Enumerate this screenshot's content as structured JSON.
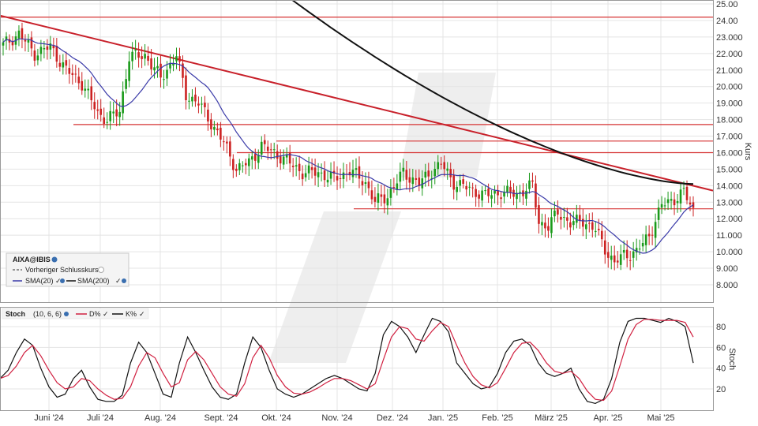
{
  "chart_data": [
    {
      "type": "candlestick",
      "symbol": "AIXA@IBIS",
      "ylabel": "Kurs",
      "ylim": [
        7.0,
        25.0
      ],
      "y_ticks": [
        "8.000",
        "9.000",
        "10.000",
        "11.000",
        "12.000",
        "13.000",
        "14.000",
        "15.000",
        "16.000",
        "17.000",
        "18.000",
        "19.000",
        "20.000",
        "21.000",
        "22.000",
        "23.000",
        "24.00",
        "25.00"
      ],
      "x_labels": [
        "Juni '24",
        "Juli '24",
        "Aug. '24",
        "Sept. '24",
        "Okt. '24",
        "Nov. '24",
        "Dez. '24",
        "Jan. '25",
        "Feb. '25",
        "März '25",
        "Apr. '25",
        "Mai '25"
      ],
      "legend": {
        "title": "AIXA@IBIS",
        "items": [
          "Vorheriger Schlusskurs",
          "SMA(20)",
          "SMA(200)"
        ]
      },
      "close_anchors": [
        [
          0,
          22.5
        ],
        [
          5,
          23.2
        ],
        [
          10,
          22.0
        ],
        [
          15,
          22.4
        ],
        [
          20,
          21.0
        ],
        [
          25,
          20.2
        ],
        [
          30,
          18.4
        ],
        [
          33,
          18.0
        ],
        [
          37,
          18.5
        ],
        [
          40,
          21.8
        ],
        [
          45,
          21.9
        ],
        [
          50,
          20.5
        ],
        [
          55,
          21.9
        ],
        [
          58,
          19.5
        ],
        [
          62,
          19.0
        ],
        [
          66,
          17.8
        ],
        [
          70,
          16.6
        ],
        [
          74,
          15.0
        ],
        [
          78,
          15.4
        ],
        [
          82,
          16.4
        ],
        [
          86,
          16.0
        ],
        [
          90,
          15.5
        ],
        [
          95,
          14.8
        ],
        [
          100,
          14.8
        ],
        [
          105,
          14.4
        ],
        [
          110,
          14.9
        ],
        [
          115,
          14.2
        ],
        [
          118,
          13.0
        ],
        [
          122,
          13.4
        ],
        [
          127,
          14.8
        ],
        [
          132,
          14.1
        ],
        [
          136,
          14.9
        ],
        [
          139,
          15.3
        ],
        [
          143,
          14.2
        ],
        [
          148,
          13.8
        ],
        [
          153,
          13.4
        ],
        [
          158,
          13.6
        ],
        [
          163,
          13.5
        ],
        [
          168,
          14.0
        ],
        [
          170,
          11.8
        ],
        [
          173,
          11.5
        ],
        [
          176,
          12.4
        ],
        [
          180,
          11.7
        ],
        [
          184,
          11.9
        ],
        [
          188,
          11.3
        ],
        [
          191,
          10.2
        ],
        [
          194,
          9.3
        ],
        [
          197,
          9.8
        ],
        [
          201,
          10.0
        ],
        [
          205,
          11.0
        ],
        [
          209,
          12.8
        ],
        [
          213,
          13.2
        ],
        [
          216,
          13.6
        ],
        [
          219,
          12.5
        ]
      ],
      "close_start": 22.5,
      "close_end": 12.5,
      "sma200_start": 27.2,
      "sma200_end": 14.1,
      "resistance_levels": [
        24.2,
        17.7,
        16.7,
        16.0,
        12.6
      ],
      "trendline": {
        "start": 24.3,
        "end": 13.7
      },
      "line_colors": {
        "price_up": "#1a9a1a",
        "price_down": "#cc2222",
        "sma20": "#3a3aa8",
        "sma200": "#111111",
        "levels": "#d63333",
        "trend": "#c8202a"
      }
    },
    {
      "type": "line",
      "title": "Stoch",
      "params": "(10, 6, 6)",
      "ylabel": "Stoch",
      "ylim": [
        0,
        100
      ],
      "y_ticks": [
        "20",
        "40",
        "60",
        "80"
      ],
      "series": [
        {
          "name": "K%",
          "color": "#111111",
          "values": [
            30,
            38,
            55,
            68,
            62,
            40,
            22,
            12,
            15,
            30,
            38,
            22,
            10,
            8,
            8,
            14,
            45,
            65,
            55,
            35,
            15,
            12,
            45,
            70,
            55,
            38,
            22,
            12,
            10,
            15,
            45,
            70,
            60,
            38,
            20,
            15,
            12,
            15,
            20,
            25,
            30,
            33,
            30,
            25,
            20,
            18,
            35,
            72,
            85,
            80,
            70,
            55,
            72,
            88,
            85,
            75,
            45,
            35,
            25,
            20,
            22,
            35,
            55,
            66,
            68,
            62,
            45,
            35,
            32,
            35,
            40,
            20,
            8,
            6,
            10,
            30,
            65,
            85,
            88,
            88,
            86,
            84,
            88,
            85,
            80,
            45
          ]
        },
        {
          "name": "D%",
          "color": "#d02040",
          "values": [
            30,
            33,
            42,
            55,
            62,
            52,
            38,
            26,
            20,
            22,
            30,
            28,
            20,
            14,
            10,
            11,
            22,
            42,
            55,
            50,
            35,
            22,
            26,
            48,
            56,
            48,
            35,
            22,
            15,
            13,
            25,
            50,
            62,
            50,
            33,
            22,
            16,
            15,
            17,
            21,
            26,
            30,
            30,
            28,
            24,
            20,
            25,
            48,
            70,
            80,
            78,
            68,
            66,
            76,
            84,
            80,
            62,
            45,
            32,
            24,
            21,
            26,
            40,
            55,
            64,
            65,
            57,
            45,
            37,
            35,
            37,
            30,
            18,
            10,
            9,
            18,
            42,
            68,
            82,
            87,
            87,
            86,
            86,
            86,
            84,
            70
          ]
        }
      ]
    }
  ]
}
